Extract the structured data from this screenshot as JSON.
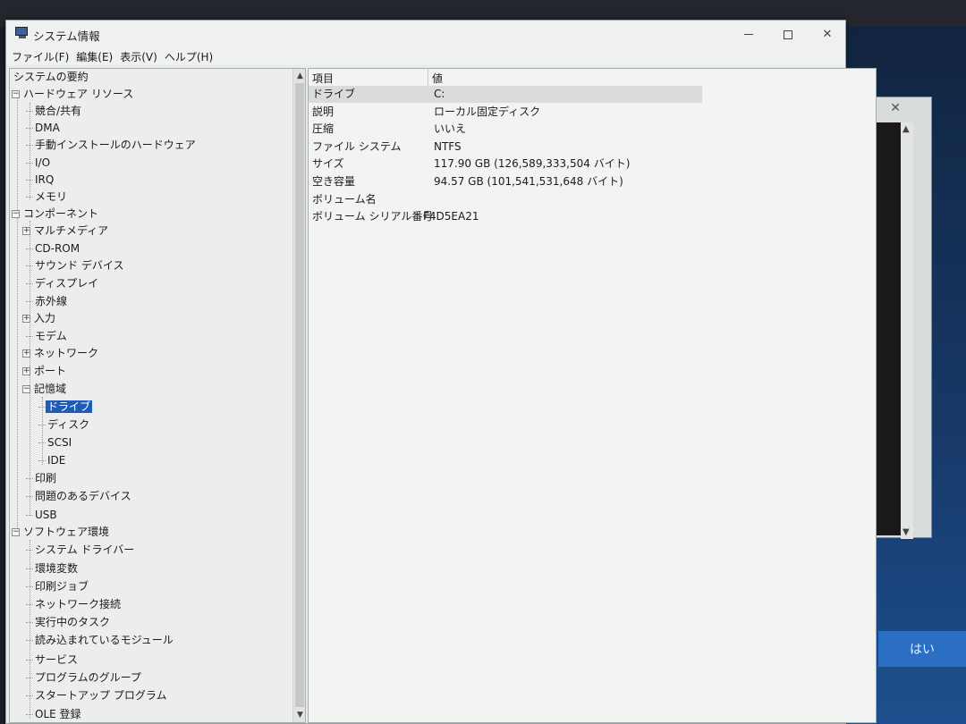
{
  "window": {
    "title": "システム情報",
    "minimize": "—",
    "maximize": "□",
    "close": "✕"
  },
  "menu": {
    "file": "ファイル(F)",
    "edit": "編集(E)",
    "view": "表示(V)",
    "help": "ヘルプ(H)"
  },
  "tree": {
    "items": [
      {
        "label": "システムの要約"
      },
      {
        "label": "ハードウェア リソース",
        "toggle": "⊟"
      },
      {
        "label": "競合/共有"
      },
      {
        "label": "DMA"
      },
      {
        "label": "手動インストールのハードウェア"
      },
      {
        "label": "I/O"
      },
      {
        "label": "IRQ"
      },
      {
        "label": "メモリ"
      },
      {
        "label": "コンポーネント",
        "toggle": "⊟"
      },
      {
        "label": "マルチメディア",
        "toggle": "⊞"
      },
      {
        "label": "CD-ROM"
      },
      {
        "label": "サウンド デバイス"
      },
      {
        "label": "ディスプレイ"
      },
      {
        "label": "赤外線"
      },
      {
        "label": "入力",
        "toggle": "⊞"
      },
      {
        "label": "モデム"
      },
      {
        "label": "ネットワーク",
        "toggle": "⊞"
      },
      {
        "label": "ポート",
        "toggle": "⊞"
      },
      {
        "label": "記憶域",
        "toggle": "⊟"
      },
      {
        "label": "ドライブ"
      },
      {
        "label": "ディスク"
      },
      {
        "label": "SCSI"
      },
      {
        "label": "IDE"
      },
      {
        "label": "印刷"
      },
      {
        "label": "問題のあるデバイス"
      },
      {
        "label": "USB"
      },
      {
        "label": "ソフトウェア環境",
        "toggle": "⊟"
      },
      {
        "label": "システム ドライバー"
      },
      {
        "label": "環境変数"
      },
      {
        "label": "印刷ジョブ"
      },
      {
        "label": "ネットワーク接続"
      },
      {
        "label": "実行中のタスク"
      },
      {
        "label": "読み込まれているモジュール"
      },
      {
        "label": "サービス"
      },
      {
        "label": "プログラムのグループ"
      },
      {
        "label": "スタートアップ プログラム"
      },
      {
        "label": "OLE 登録"
      }
    ],
    "scroll_up": "▲",
    "scroll_down": "▼"
  },
  "detail": {
    "header_key": "項目",
    "header_value": "値",
    "rows": [
      {
        "key": "ドライブ",
        "value": "C:"
      },
      {
        "key": "説明",
        "value": "ローカル固定ディスク"
      },
      {
        "key": "圧縮",
        "value": "いいえ"
      },
      {
        "key": "ファイル システム",
        "value": "NTFS"
      },
      {
        "key": "サイズ",
        "value": "117.90 GB (126,589,333,504 バイト)"
      },
      {
        "key": "空き容量",
        "value": "94.57 GB (101,541,531,648 バイト)"
      },
      {
        "key": "ボリューム名",
        "value": ""
      },
      {
        "key": "ボリューム シリアル番号",
        "value": "F4D5EA21"
      }
    ]
  },
  "background_dialog": {
    "yes_button": "はい",
    "close": "✕",
    "scroll_down": "▼",
    "scroll_up": "▲"
  }
}
